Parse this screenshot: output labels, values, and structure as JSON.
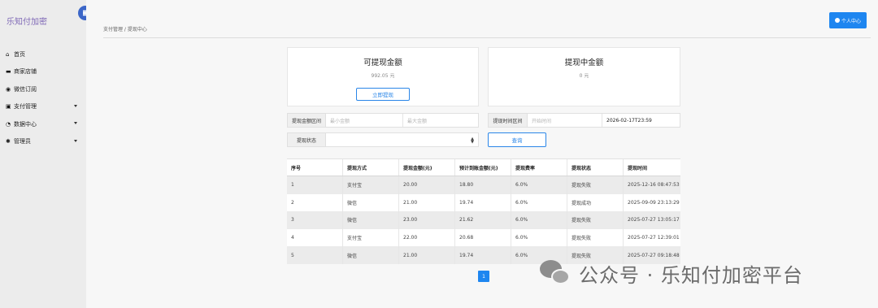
{
  "app": {
    "brand": "乐知付加密"
  },
  "sidebar": {
    "items": [
      {
        "label": "首页",
        "icon": "home-icon",
        "glyph": "⌂",
        "caret": false
      },
      {
        "label": "商家店铺",
        "icon": "briefcase-icon",
        "glyph": "▬",
        "caret": false
      },
      {
        "label": "微信订阅",
        "icon": "wechat-icon",
        "glyph": "◉",
        "caret": false
      },
      {
        "label": "支付管理",
        "icon": "payment-icon",
        "glyph": "▣",
        "caret": true
      },
      {
        "label": "数据中心",
        "icon": "pie-chart-icon",
        "glyph": "◔",
        "caret": true
      },
      {
        "label": "管理员",
        "icon": "gear-icon",
        "glyph": "✱",
        "caret": true
      }
    ]
  },
  "header": {
    "breadcrumb": "支付管理 / 提现中心",
    "profile_label": "个人中心"
  },
  "cards": {
    "available": {
      "title": "可提现金额",
      "amount": "992.05 元",
      "button": "立即提现"
    },
    "pending": {
      "title": "提现中金额",
      "amount": "0 元"
    }
  },
  "filters": {
    "amount_label": "提现金额区间",
    "amount_min_placeholder": "最小金额",
    "amount_max_placeholder": "最大金额",
    "time_label": "提现时间区间",
    "time_start_placeholder": "开始时间",
    "time_end_value": "2026-02-17T23:59",
    "status_label": "提现状态",
    "status_value": "",
    "query_button": "查询"
  },
  "table": {
    "headers": [
      "序号",
      "提现方式",
      "提现金额(元)",
      "预计到账金额(元)",
      "提现费率",
      "提现状态",
      "提现时间"
    ],
    "rows": [
      [
        "1",
        "支付宝",
        "20.00",
        "18.80",
        "6.0%",
        "提现失败",
        "2025-12-16 08:47:53"
      ],
      [
        "2",
        "微信",
        "21.00",
        "19.74",
        "6.0%",
        "提现成功",
        "2025-09-09 23:13:29"
      ],
      [
        "3",
        "微信",
        "23.00",
        "21.62",
        "6.0%",
        "提现失败",
        "2025-07-27 13:05:17"
      ],
      [
        "4",
        "支付宝",
        "22.00",
        "20.68",
        "6.0%",
        "提现失败",
        "2025-07-27 12:39:01"
      ],
      [
        "5",
        "微信",
        "21.00",
        "19.74",
        "6.0%",
        "提现失败",
        "2025-07-27 09:18:48"
      ]
    ]
  },
  "pagination": {
    "current": "1"
  },
  "watermark": {
    "text": "公众号 · 乐知付加密平台"
  }
}
